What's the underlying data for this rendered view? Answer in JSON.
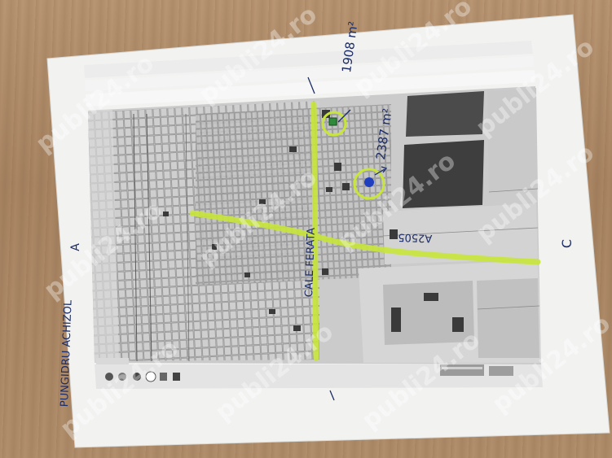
{
  "watermark": {
    "text": "publi24.ro"
  },
  "annotations": {
    "area_1": "1908 m²",
    "area_2": "2387 m²",
    "road_main": "CALE FERATA",
    "road_cross": "A2505",
    "margin_label": "PUNGIDRU ACHIZOL",
    "side_letter": "C",
    "top_letter": "A"
  },
  "colors": {
    "highlight": "#c8e63a",
    "pin_blue": "#1f3fbf",
    "pin_green": "#2f8a3a",
    "ink": "#1c2c66",
    "paper": "#f2f3f1"
  }
}
